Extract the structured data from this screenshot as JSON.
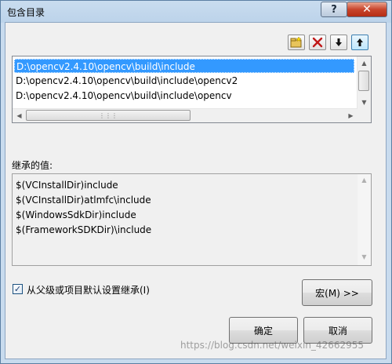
{
  "window": {
    "title": "包含目录",
    "help_glyph": "?",
    "close_glyph": "✕"
  },
  "toolbar": {
    "new_line_icon": "new-folder-icon",
    "delete_icon": "delete-icon",
    "move_down_icon": "down-arrow-icon",
    "move_up_icon": "up-arrow-icon"
  },
  "list": {
    "items": [
      "D:\\opencv2.4.10\\opencv\\build\\include",
      "D:\\opencv2.4.10\\opencv\\build\\include\\opencv2",
      "D:\\opencv2.4.10\\opencv\\build\\include\\opencv"
    ],
    "selected_index": 0
  },
  "inherited": {
    "label": "继承的值:",
    "items": [
      "$(VCInstallDir)include",
      "$(VCInstallDir)atlmfc\\include",
      "$(WindowsSdkDir)include",
      "$(FrameworkSDKDir)\\include"
    ]
  },
  "inherit_checkbox": {
    "label": "从父级或项目默认设置继承(I)",
    "checked": true
  },
  "buttons": {
    "macro": "宏(M) >>",
    "ok": "确定",
    "cancel": "取消"
  },
  "watermark": "https://blog.csdn.net/weixin_42662955",
  "colors": {
    "selection": "#3399ff",
    "close_button": "#c8452c"
  }
}
